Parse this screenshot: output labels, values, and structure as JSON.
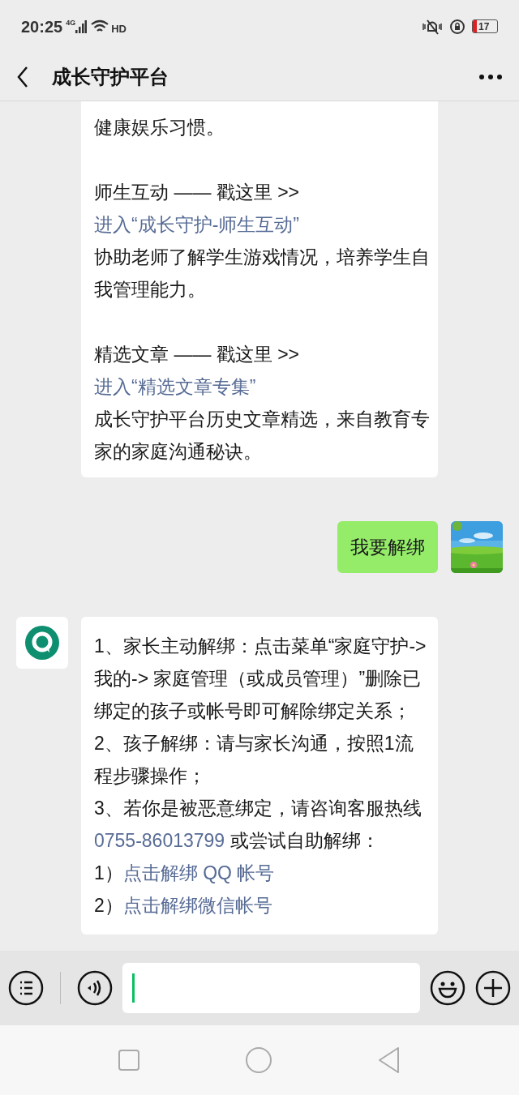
{
  "status_bar": {
    "time": "20:25",
    "network": "4G",
    "call": "HD",
    "battery": "17"
  },
  "header": {
    "title": "成长守护平台"
  },
  "messages": [
    {
      "kind": "incoming_continued",
      "groups": [
        [
          {
            "parts": [
              {
                "kind": "text",
                "text": "健康娱乐习惯。"
              }
            ]
          }
        ],
        [
          {
            "parts": [
              {
                "kind": "text",
                "text": "师生互动 —— 戳这里 >> "
              },
              {
                "kind": "link",
                "text": "进入“成长守护-师生互动”"
              }
            ]
          },
          {
            "parts": [
              {
                "kind": "text",
                "text": "协助老师了解学生游戏情况，培养学生自我管理能力。"
              }
            ]
          }
        ],
        [
          {
            "parts": [
              {
                "kind": "text",
                "text": "精选文章 —— 戳这里 >> "
              },
              {
                "kind": "link",
                "text": "进入“精选文章专集”"
              }
            ]
          },
          {
            "parts": [
              {
                "kind": "text",
                "text": "成长守护平台历史文章精选，来自教育专家的家庭沟通秘诀。"
              }
            ]
          }
        ]
      ]
    },
    {
      "kind": "outgoing",
      "groups": [
        [
          {
            "parts": [
              {
                "kind": "text",
                "text": "我要解绑"
              }
            ]
          }
        ]
      ]
    },
    {
      "kind": "incoming",
      "groups": [
        [
          {
            "parts": [
              {
                "kind": "text",
                "text": "1、家长主动解绑：点击菜单“家庭守护-> 我的-> 家庭管理（或成员管理）”删除已绑定的孩子或帐号即可解除绑定关系；"
              }
            ]
          },
          {
            "parts": [
              {
                "kind": "text",
                "text": "2、孩子解绑：请与家长沟通，按照1流程步骤操作；"
              }
            ]
          },
          {
            "parts": [
              {
                "kind": "text",
                "text": "3、若你是被恶意绑定，请咨询客服热线 "
              },
              {
                "kind": "link",
                "text": "0755-86013799"
              },
              {
                "kind": "text",
                "text": " 或尝试自助解绑："
              }
            ]
          },
          {
            "parts": [
              {
                "kind": "text",
                "text": "1）"
              },
              {
                "kind": "link",
                "text": "点击解绑 QQ 帐号"
              }
            ]
          },
          {
            "parts": [
              {
                "kind": "text",
                "text": "2）"
              },
              {
                "kind": "link",
                "text": "点击解绑微信帐号"
              }
            ]
          }
        ]
      ]
    }
  ]
}
